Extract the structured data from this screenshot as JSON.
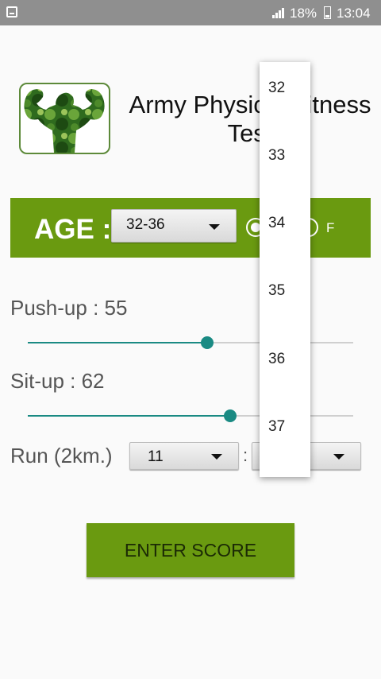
{
  "status_bar": {
    "battery_text": "18%",
    "time": "13:04"
  },
  "header": {
    "title_line1": "Army Physical Fitness",
    "title_line2": "Test"
  },
  "age": {
    "label": "AGE :",
    "selected_range": "32-36",
    "gender_female_label": "F",
    "gender_male_checked": true
  },
  "pushup": {
    "label": "Push-up : 55",
    "level": 0.55
  },
  "situp": {
    "label": "Sit-up : 62",
    "level": 0.62
  },
  "run": {
    "label": "Run (2km.)",
    "minutes": "11",
    "separator": ":"
  },
  "enter_button": "ENTER SCORE",
  "dropdown_options": [
    "32",
    "33",
    "34",
    "35",
    "36",
    "37"
  ],
  "colors": {
    "accent_green": "#6a9a10",
    "slider_teal": "#1a8a83"
  }
}
